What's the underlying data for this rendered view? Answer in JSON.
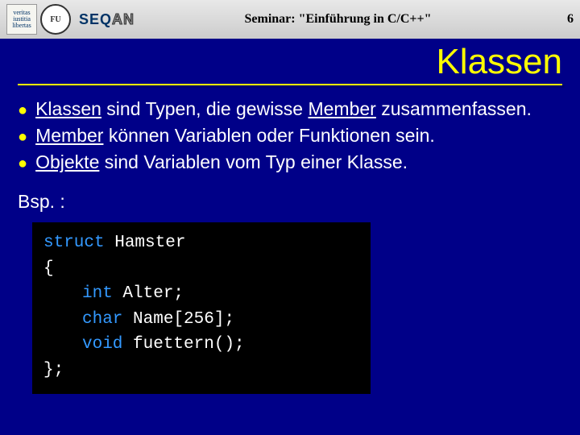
{
  "header": {
    "logo1_text": "veritas\niustitia\nlibertas",
    "logo2_text": "FU",
    "seq": "SEQ",
    "an": "AN",
    "seminar": "Seminar: \"Einführung in C/C++\"",
    "page": "6"
  },
  "title": "Klassen",
  "bullets": [
    {
      "pre": "",
      "u": "Klassen",
      "post": " sind Typen, die gewisse ",
      "u2": "Member",
      "post2": " zusammenfassen."
    },
    {
      "pre": "",
      "u": "Member",
      "post": " können Variablen oder Funktionen sein."
    },
    {
      "pre": "",
      "u": "Objekte",
      "post": " sind Variablen vom Typ einer Klasse."
    }
  ],
  "example": "Bsp. :",
  "code": {
    "l1_kw": "struct",
    "l1_rest": " Hamster",
    "l2": "{",
    "l3_kw": "int",
    "l3_rest": " Alter;",
    "l4_kw": "char",
    "l4_rest": " Name[256];",
    "l5_kw": "void",
    "l5_rest": " fuettern();",
    "l6": "};"
  }
}
